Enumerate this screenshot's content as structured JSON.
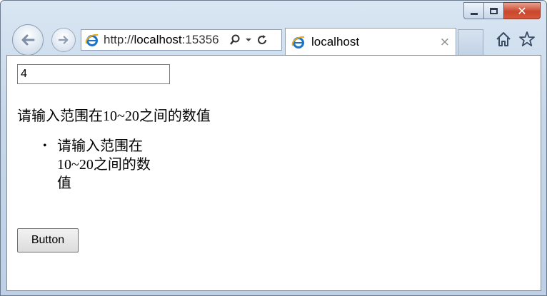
{
  "browser": {
    "address": {
      "prefix": "http://",
      "host": "localhost",
      "port_partial": ":15356"
    },
    "tab": {
      "title": "localhost",
      "close": "×"
    },
    "caption": {
      "close": "✕"
    },
    "icons": {
      "back": "back-arrow-icon",
      "forward": "forward-arrow-icon",
      "ie": "internet-explorer-icon",
      "search": "search-icon",
      "dropdown": "chevron-down-icon",
      "refresh": "refresh-icon",
      "home": "home-icon",
      "favorites": "star-icon"
    }
  },
  "page": {
    "input_value": "4",
    "validation_message": "请输入范围在10~20之间的数值",
    "summary_items": [
      "请输入范围在10~20之间的数值"
    ],
    "button_label": "Button"
  }
}
